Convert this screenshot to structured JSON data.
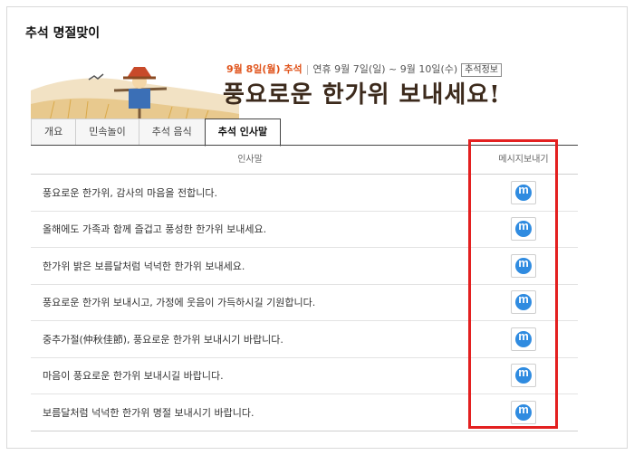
{
  "page_title": "추석 명절맞이",
  "banner": {
    "date_main": "9월 8일(월) 추석",
    "holiday_range": "연휴 9월 7일(일) ~ 9월 10일(수)",
    "info_button": "추석정보",
    "slogan": "풍요로운 한가위 보내세요!"
  },
  "tabs": [
    {
      "label": "개요",
      "active": false
    },
    {
      "label": "민속놀이",
      "active": false
    },
    {
      "label": "추석 음식",
      "active": false
    },
    {
      "label": "추석 인사말",
      "active": true
    }
  ],
  "table": {
    "col_message": "인사말",
    "col_send": "메시지보내기",
    "send_icon": "messenger-m-icon",
    "rows": [
      "풍요로운 한가위, 감사의 마음을 전합니다.",
      "올해에도 가족과 함께 즐겁고 풍성한 한가위 보내세요.",
      "한가위 밝은 보름달처럼 넉넉한 한가위 보내세요.",
      "풍요로운 한가위 보내시고, 가정에 웃음이 가득하시길 기원합니다.",
      "중추가절(仲秋佳節), 풍요로운 한가위 보내시기 바랍니다.",
      "마음이 풍요로운 한가위 보내시길 바랍니다.",
      "보름달처럼 넉넉한 한가위 명절 보내시기 바랍니다."
    ]
  },
  "colors": {
    "highlight": "#e32020",
    "accent": "#e0541c",
    "icon_blue": "#2f8be0"
  }
}
